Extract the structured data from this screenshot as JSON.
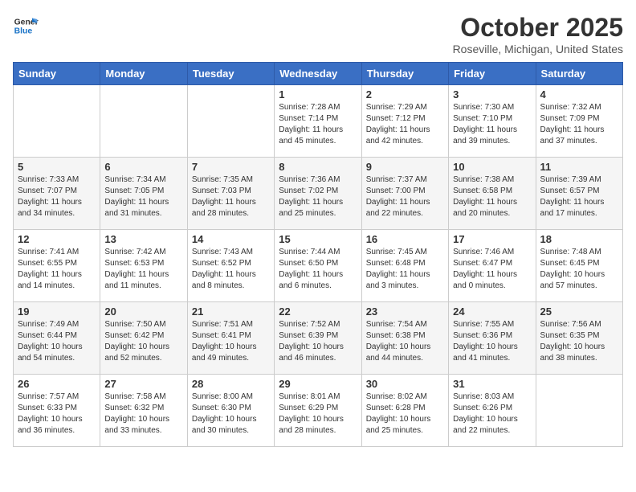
{
  "logo": {
    "line1": "General",
    "line2": "Blue"
  },
  "header": {
    "month": "October 2025",
    "location": "Roseville, Michigan, United States"
  },
  "weekdays": [
    "Sunday",
    "Monday",
    "Tuesday",
    "Wednesday",
    "Thursday",
    "Friday",
    "Saturday"
  ],
  "weeks": [
    [
      {
        "day": "",
        "info": ""
      },
      {
        "day": "",
        "info": ""
      },
      {
        "day": "",
        "info": ""
      },
      {
        "day": "1",
        "info": "Sunrise: 7:28 AM\nSunset: 7:14 PM\nDaylight: 11 hours\nand 45 minutes."
      },
      {
        "day": "2",
        "info": "Sunrise: 7:29 AM\nSunset: 7:12 PM\nDaylight: 11 hours\nand 42 minutes."
      },
      {
        "day": "3",
        "info": "Sunrise: 7:30 AM\nSunset: 7:10 PM\nDaylight: 11 hours\nand 39 minutes."
      },
      {
        "day": "4",
        "info": "Sunrise: 7:32 AM\nSunset: 7:09 PM\nDaylight: 11 hours\nand 37 minutes."
      }
    ],
    [
      {
        "day": "5",
        "info": "Sunrise: 7:33 AM\nSunset: 7:07 PM\nDaylight: 11 hours\nand 34 minutes."
      },
      {
        "day": "6",
        "info": "Sunrise: 7:34 AM\nSunset: 7:05 PM\nDaylight: 11 hours\nand 31 minutes."
      },
      {
        "day": "7",
        "info": "Sunrise: 7:35 AM\nSunset: 7:03 PM\nDaylight: 11 hours\nand 28 minutes."
      },
      {
        "day": "8",
        "info": "Sunrise: 7:36 AM\nSunset: 7:02 PM\nDaylight: 11 hours\nand 25 minutes."
      },
      {
        "day": "9",
        "info": "Sunrise: 7:37 AM\nSunset: 7:00 PM\nDaylight: 11 hours\nand 22 minutes."
      },
      {
        "day": "10",
        "info": "Sunrise: 7:38 AM\nSunset: 6:58 PM\nDaylight: 11 hours\nand 20 minutes."
      },
      {
        "day": "11",
        "info": "Sunrise: 7:39 AM\nSunset: 6:57 PM\nDaylight: 11 hours\nand 17 minutes."
      }
    ],
    [
      {
        "day": "12",
        "info": "Sunrise: 7:41 AM\nSunset: 6:55 PM\nDaylight: 11 hours\nand 14 minutes."
      },
      {
        "day": "13",
        "info": "Sunrise: 7:42 AM\nSunset: 6:53 PM\nDaylight: 11 hours\nand 11 minutes."
      },
      {
        "day": "14",
        "info": "Sunrise: 7:43 AM\nSunset: 6:52 PM\nDaylight: 11 hours\nand 8 minutes."
      },
      {
        "day": "15",
        "info": "Sunrise: 7:44 AM\nSunset: 6:50 PM\nDaylight: 11 hours\nand 6 minutes."
      },
      {
        "day": "16",
        "info": "Sunrise: 7:45 AM\nSunset: 6:48 PM\nDaylight: 11 hours\nand 3 minutes."
      },
      {
        "day": "17",
        "info": "Sunrise: 7:46 AM\nSunset: 6:47 PM\nDaylight: 11 hours\nand 0 minutes."
      },
      {
        "day": "18",
        "info": "Sunrise: 7:48 AM\nSunset: 6:45 PM\nDaylight: 10 hours\nand 57 minutes."
      }
    ],
    [
      {
        "day": "19",
        "info": "Sunrise: 7:49 AM\nSunset: 6:44 PM\nDaylight: 10 hours\nand 54 minutes."
      },
      {
        "day": "20",
        "info": "Sunrise: 7:50 AM\nSunset: 6:42 PM\nDaylight: 10 hours\nand 52 minutes."
      },
      {
        "day": "21",
        "info": "Sunrise: 7:51 AM\nSunset: 6:41 PM\nDaylight: 10 hours\nand 49 minutes."
      },
      {
        "day": "22",
        "info": "Sunrise: 7:52 AM\nSunset: 6:39 PM\nDaylight: 10 hours\nand 46 minutes."
      },
      {
        "day": "23",
        "info": "Sunrise: 7:54 AM\nSunset: 6:38 PM\nDaylight: 10 hours\nand 44 minutes."
      },
      {
        "day": "24",
        "info": "Sunrise: 7:55 AM\nSunset: 6:36 PM\nDaylight: 10 hours\nand 41 minutes."
      },
      {
        "day": "25",
        "info": "Sunrise: 7:56 AM\nSunset: 6:35 PM\nDaylight: 10 hours\nand 38 minutes."
      }
    ],
    [
      {
        "day": "26",
        "info": "Sunrise: 7:57 AM\nSunset: 6:33 PM\nDaylight: 10 hours\nand 36 minutes."
      },
      {
        "day": "27",
        "info": "Sunrise: 7:58 AM\nSunset: 6:32 PM\nDaylight: 10 hours\nand 33 minutes."
      },
      {
        "day": "28",
        "info": "Sunrise: 8:00 AM\nSunset: 6:30 PM\nDaylight: 10 hours\nand 30 minutes."
      },
      {
        "day": "29",
        "info": "Sunrise: 8:01 AM\nSunset: 6:29 PM\nDaylight: 10 hours\nand 28 minutes."
      },
      {
        "day": "30",
        "info": "Sunrise: 8:02 AM\nSunset: 6:28 PM\nDaylight: 10 hours\nand 25 minutes."
      },
      {
        "day": "31",
        "info": "Sunrise: 8:03 AM\nSunset: 6:26 PM\nDaylight: 10 hours\nand 22 minutes."
      },
      {
        "day": "",
        "info": ""
      }
    ]
  ]
}
